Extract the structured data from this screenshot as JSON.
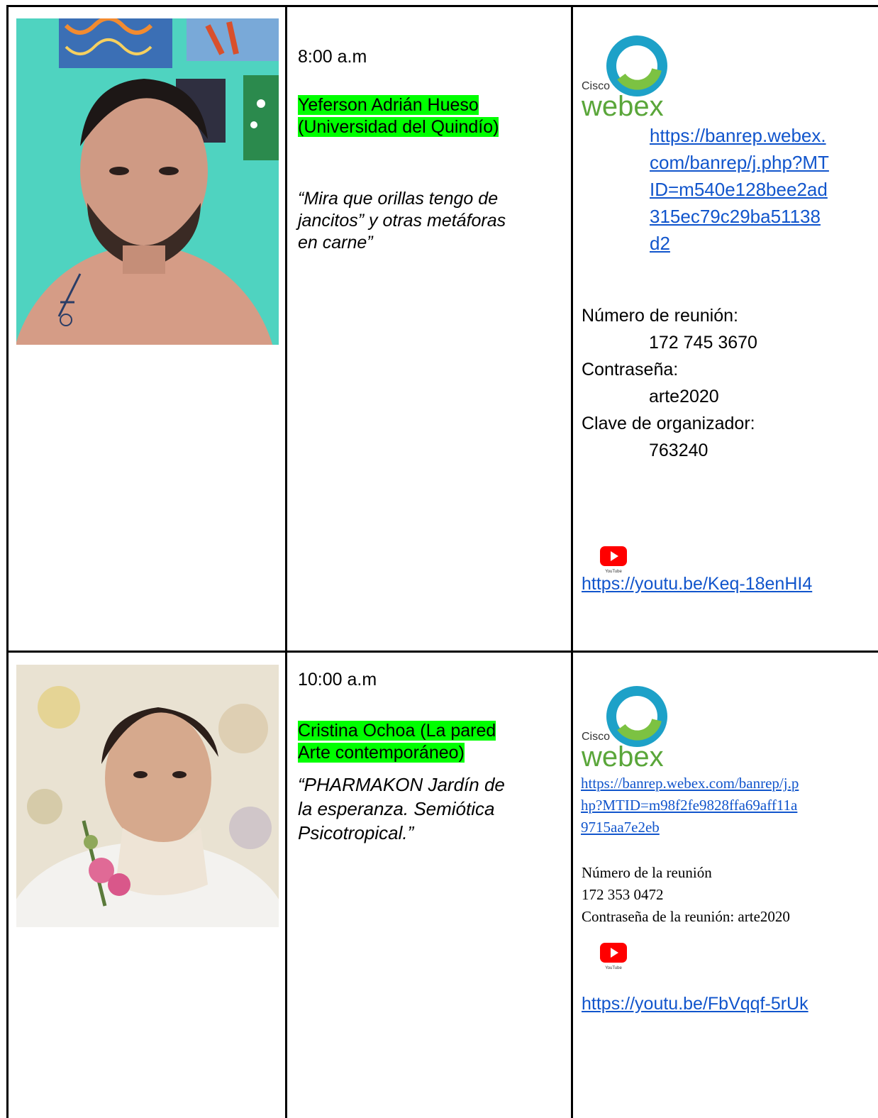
{
  "rows": [
    {
      "time": "8:00 a.m",
      "speaker_line1": "Yeferson Adrián Hueso",
      "speaker_line2": "(Universidad del Quindío)",
      "talk_line1": "“Mira que orillas tengo de",
      "talk_line2": "jancitos” y otras metáforas",
      "talk_line3": "en carne”",
      "webex_brand": "Cisco",
      "webex_word": "webex",
      "webex_link_lines": [
        "https://banrep.webex.",
        "com/banrep/j.php?MT",
        "ID=m540e128bee2ad",
        "315ec79c29ba51138",
        "d2"
      ],
      "meeting_label": "Número de reunión:",
      "meeting_number": "172 745 3670",
      "password_label": "Contraseña:",
      "password": "arte2020",
      "host_key_label": "Clave de organizador:",
      "host_key": "763240",
      "youtube_caption": "YouTube",
      "youtube_link": "https://youtu.be/Keq-18enHI4"
    },
    {
      "time": "10:00 a.m",
      "speaker_line1": "Cristina Ochoa (La pared",
      "speaker_line2": "Arte contemporáneo)",
      "talk_line1": "“PHARMAKON Jardín de",
      "talk_line2": "la esperanza. Semiótica",
      "talk_line3": "Psicotropical.”",
      "webex_brand": "Cisco",
      "webex_word": "webex",
      "webex_link_lines": [
        "https://banrep.webex.com/banrep/j.p",
        "hp?MTID=m98f2fe9828ffa69aff11a",
        "9715aa7e2eb"
      ],
      "meeting_label": "Número de la reunión",
      "meeting_number": "172 353 0472",
      "password_line": "Contraseña de la reunión: arte2020",
      "youtube_caption": "YouTube",
      "youtube_link": "https://youtu.be/FbVqqf-5rUk"
    }
  ],
  "colors": {
    "highlight": "#00ff00",
    "link": "#1155cc",
    "webex_blue": "#1da1c8",
    "webex_green": "#7cc242",
    "youtube_red": "#ff0000"
  }
}
